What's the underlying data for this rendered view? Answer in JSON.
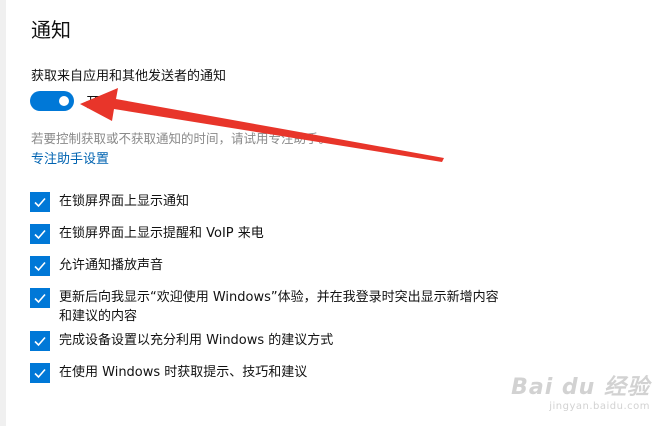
{
  "section": {
    "title": "通知",
    "setting_label": "获取来自应用和其他发送者的通知",
    "toggle_state": "开",
    "hint": "若要控制获取或不获取通知的时间，请试用专注助手。",
    "link": "专注助手设置"
  },
  "options": [
    {
      "label": "在锁屏界面上显示通知",
      "checked": true
    },
    {
      "label": "在锁屏界面上显示提醒和 VoIP 来电",
      "checked": true
    },
    {
      "label": "允许通知播放声音",
      "checked": true
    },
    {
      "label": "更新后向我显示“欢迎使用 Windows”体验，并在我登录时突出显示新增内容和建议的内容",
      "checked": true
    },
    {
      "label": "完成设备设置以充分利用 Windows 的建议方式",
      "checked": true
    },
    {
      "label": "在使用 Windows 时获取提示、技巧和建议",
      "checked": true
    }
  ],
  "colors": {
    "accent": "#0078d7",
    "link": "#0063b1",
    "annotation_arrow": "#e8352a"
  },
  "watermark": {
    "main": "Bai du 经验",
    "sub": "jingyan.baidu.com"
  }
}
